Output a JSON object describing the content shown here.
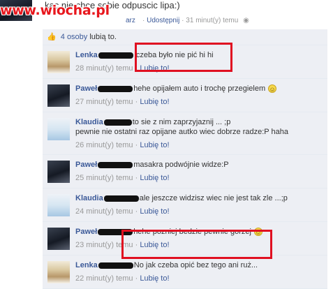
{
  "watermark": "www.wiocha.pl",
  "post": {
    "text": "kac nie chce sobie odpuscic lipa:)",
    "meta_prefix": "arz",
    "share_link": "Udostępnij",
    "time": "31 minut(y) temu",
    "globe_icon": "globe-icon"
  },
  "likes": {
    "count_label": "4 osoby",
    "suffix": "lubią to."
  },
  "comments": [
    {
      "author": "Lenka",
      "avatar": "lenka",
      "text": "czeba było nie pić hi hi",
      "time": "28 minut(y) temu",
      "like": "Lubię to!"
    },
    {
      "author": "Paweł",
      "avatar": "pawel",
      "text": "hehe opijałem auto i trochę przegielem",
      "smiley": true,
      "time": "27 minut(y) temu",
      "like": "Lubię to!"
    },
    {
      "author": "Klaudia",
      "avatar": "klaudia",
      "text": "to sie z nim zaprzyjaznij ... ;p",
      "text2": "pewnie nie ostatni raz opijane autko wiec dobrze radze:P haha",
      "time": "26 minut(y) temu",
      "like": "Lubię to!"
    },
    {
      "author": "Paweł",
      "avatar": "pawel",
      "text": "masakra podwójnie widze:P",
      "time": "25 minut(y) temu",
      "like": "Lubię to!"
    },
    {
      "author": "Klaudia",
      "avatar": "klaudia",
      "text": "ale jeszcze widzisz wiec nie jest tak zle ...;p",
      "time": "24 minut(y) temu",
      "like": "Lubię to!"
    },
    {
      "author": "Paweł",
      "avatar": "pawel",
      "text": "hehe pozniej bedzie pewnie gorzej",
      "smiley": true,
      "time": "23 minut(y) temu",
      "like": "Lubię to!"
    },
    {
      "author": "Lenka",
      "avatar": "lenka",
      "text": "No jak czeba opić bez tego ani ruż...",
      "time": "22 minut(y) temu",
      "like": "Lubię to!"
    }
  ],
  "separator": "·",
  "colors": {
    "link": "#3b5998",
    "comment_bg": "#edeff4",
    "highlight": "#e01021",
    "watermark": "#e8171d"
  }
}
